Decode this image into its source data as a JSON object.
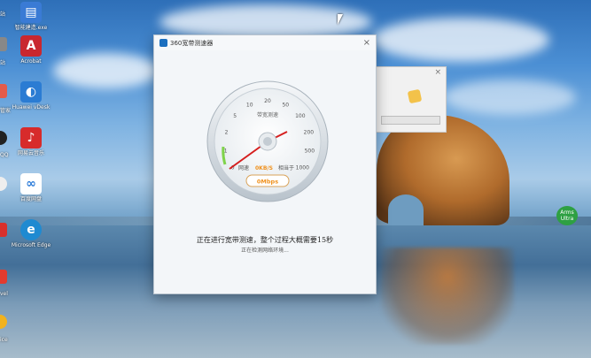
{
  "desktop": {
    "icons": [
      {
        "id": "icon-1",
        "label": "智能建造.exe",
        "color": "#3a7bd5",
        "glyph": "▤"
      },
      {
        "id": "icon-2",
        "label": "Acrobat",
        "color": "#c9272f",
        "glyph": "A"
      },
      {
        "id": "icon-3",
        "label": "Huawei vDesk",
        "color": "#2b7cd3",
        "glyph": "◐"
      },
      {
        "id": "icon-4",
        "label": "网易云音乐",
        "color": "#d72b2b",
        "glyph": "♪"
      },
      {
        "id": "icon-5",
        "label": "百度网盘",
        "color": "#ffffff",
        "glyph": "∞"
      },
      {
        "id": "icon-6",
        "label": "Microsoft Edge",
        "color": "#1f8ad1",
        "glyph": "e"
      },
      {
        "id": "icon-7",
        "label": "",
        "color": "#e33b2f",
        "glyph": "◆"
      }
    ],
    "left_edge_labels": [
      "站",
      "站",
      "管家",
      "QQ",
      "",
      "",
      "vel",
      "ice"
    ]
  },
  "main_window": {
    "title": "360宽带测速器",
    "close": "×",
    "gauge": {
      "ticks": [
        "0",
        "1",
        "2",
        "5",
        "10",
        "20",
        "50",
        "100",
        "200",
        "500",
        "1000"
      ],
      "center_label": "带宽测速",
      "left_label": "网速",
      "speed_text": "0KB/S",
      "right_label": "相当于",
      "mbps": "0Mbps"
    },
    "status_main": "正在进行宽带测速，整个过程大概需要15秒",
    "status_sub": "正在检测网络环境..."
  },
  "back_window": {
    "close": "×"
  },
  "tray_badge": "Arms\nUltra"
}
